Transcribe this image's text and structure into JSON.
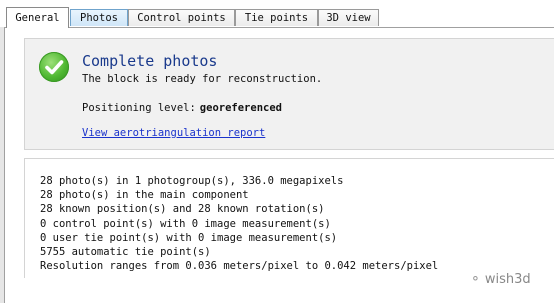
{
  "tabs": [
    {
      "label": "General",
      "active": true
    },
    {
      "label": "Photos",
      "active": false
    },
    {
      "label": "Control points",
      "active": false
    },
    {
      "label": "Tie points",
      "active": false
    },
    {
      "label": "3D view",
      "active": false
    }
  ],
  "status": {
    "icon": "checkmark-icon",
    "title": "Complete photos",
    "message": "The block is ready for reconstruction.",
    "positioning_label": "Positioning level:",
    "positioning_value": "georeferenced",
    "report_link": "View aerotriangulation report"
  },
  "info_lines": [
    "28 photo(s) in 1 photogroup(s), 336.0 megapixels",
    "28 photo(s) in the main component",
    "28 known position(s) and 28 known rotation(s)",
    "0 control point(s) with 0 image measurement(s)",
    "0 user tie point(s) with 0 image measurement(s)",
    "5755 automatic tie point(s)",
    "Resolution ranges from 0.036 meters/pixel to 0.042 meters/pixel"
  ],
  "watermark": "wish3d",
  "colors": {
    "title": "#1a3a8c",
    "link": "#1a33cc",
    "check": "#4fb832"
  }
}
